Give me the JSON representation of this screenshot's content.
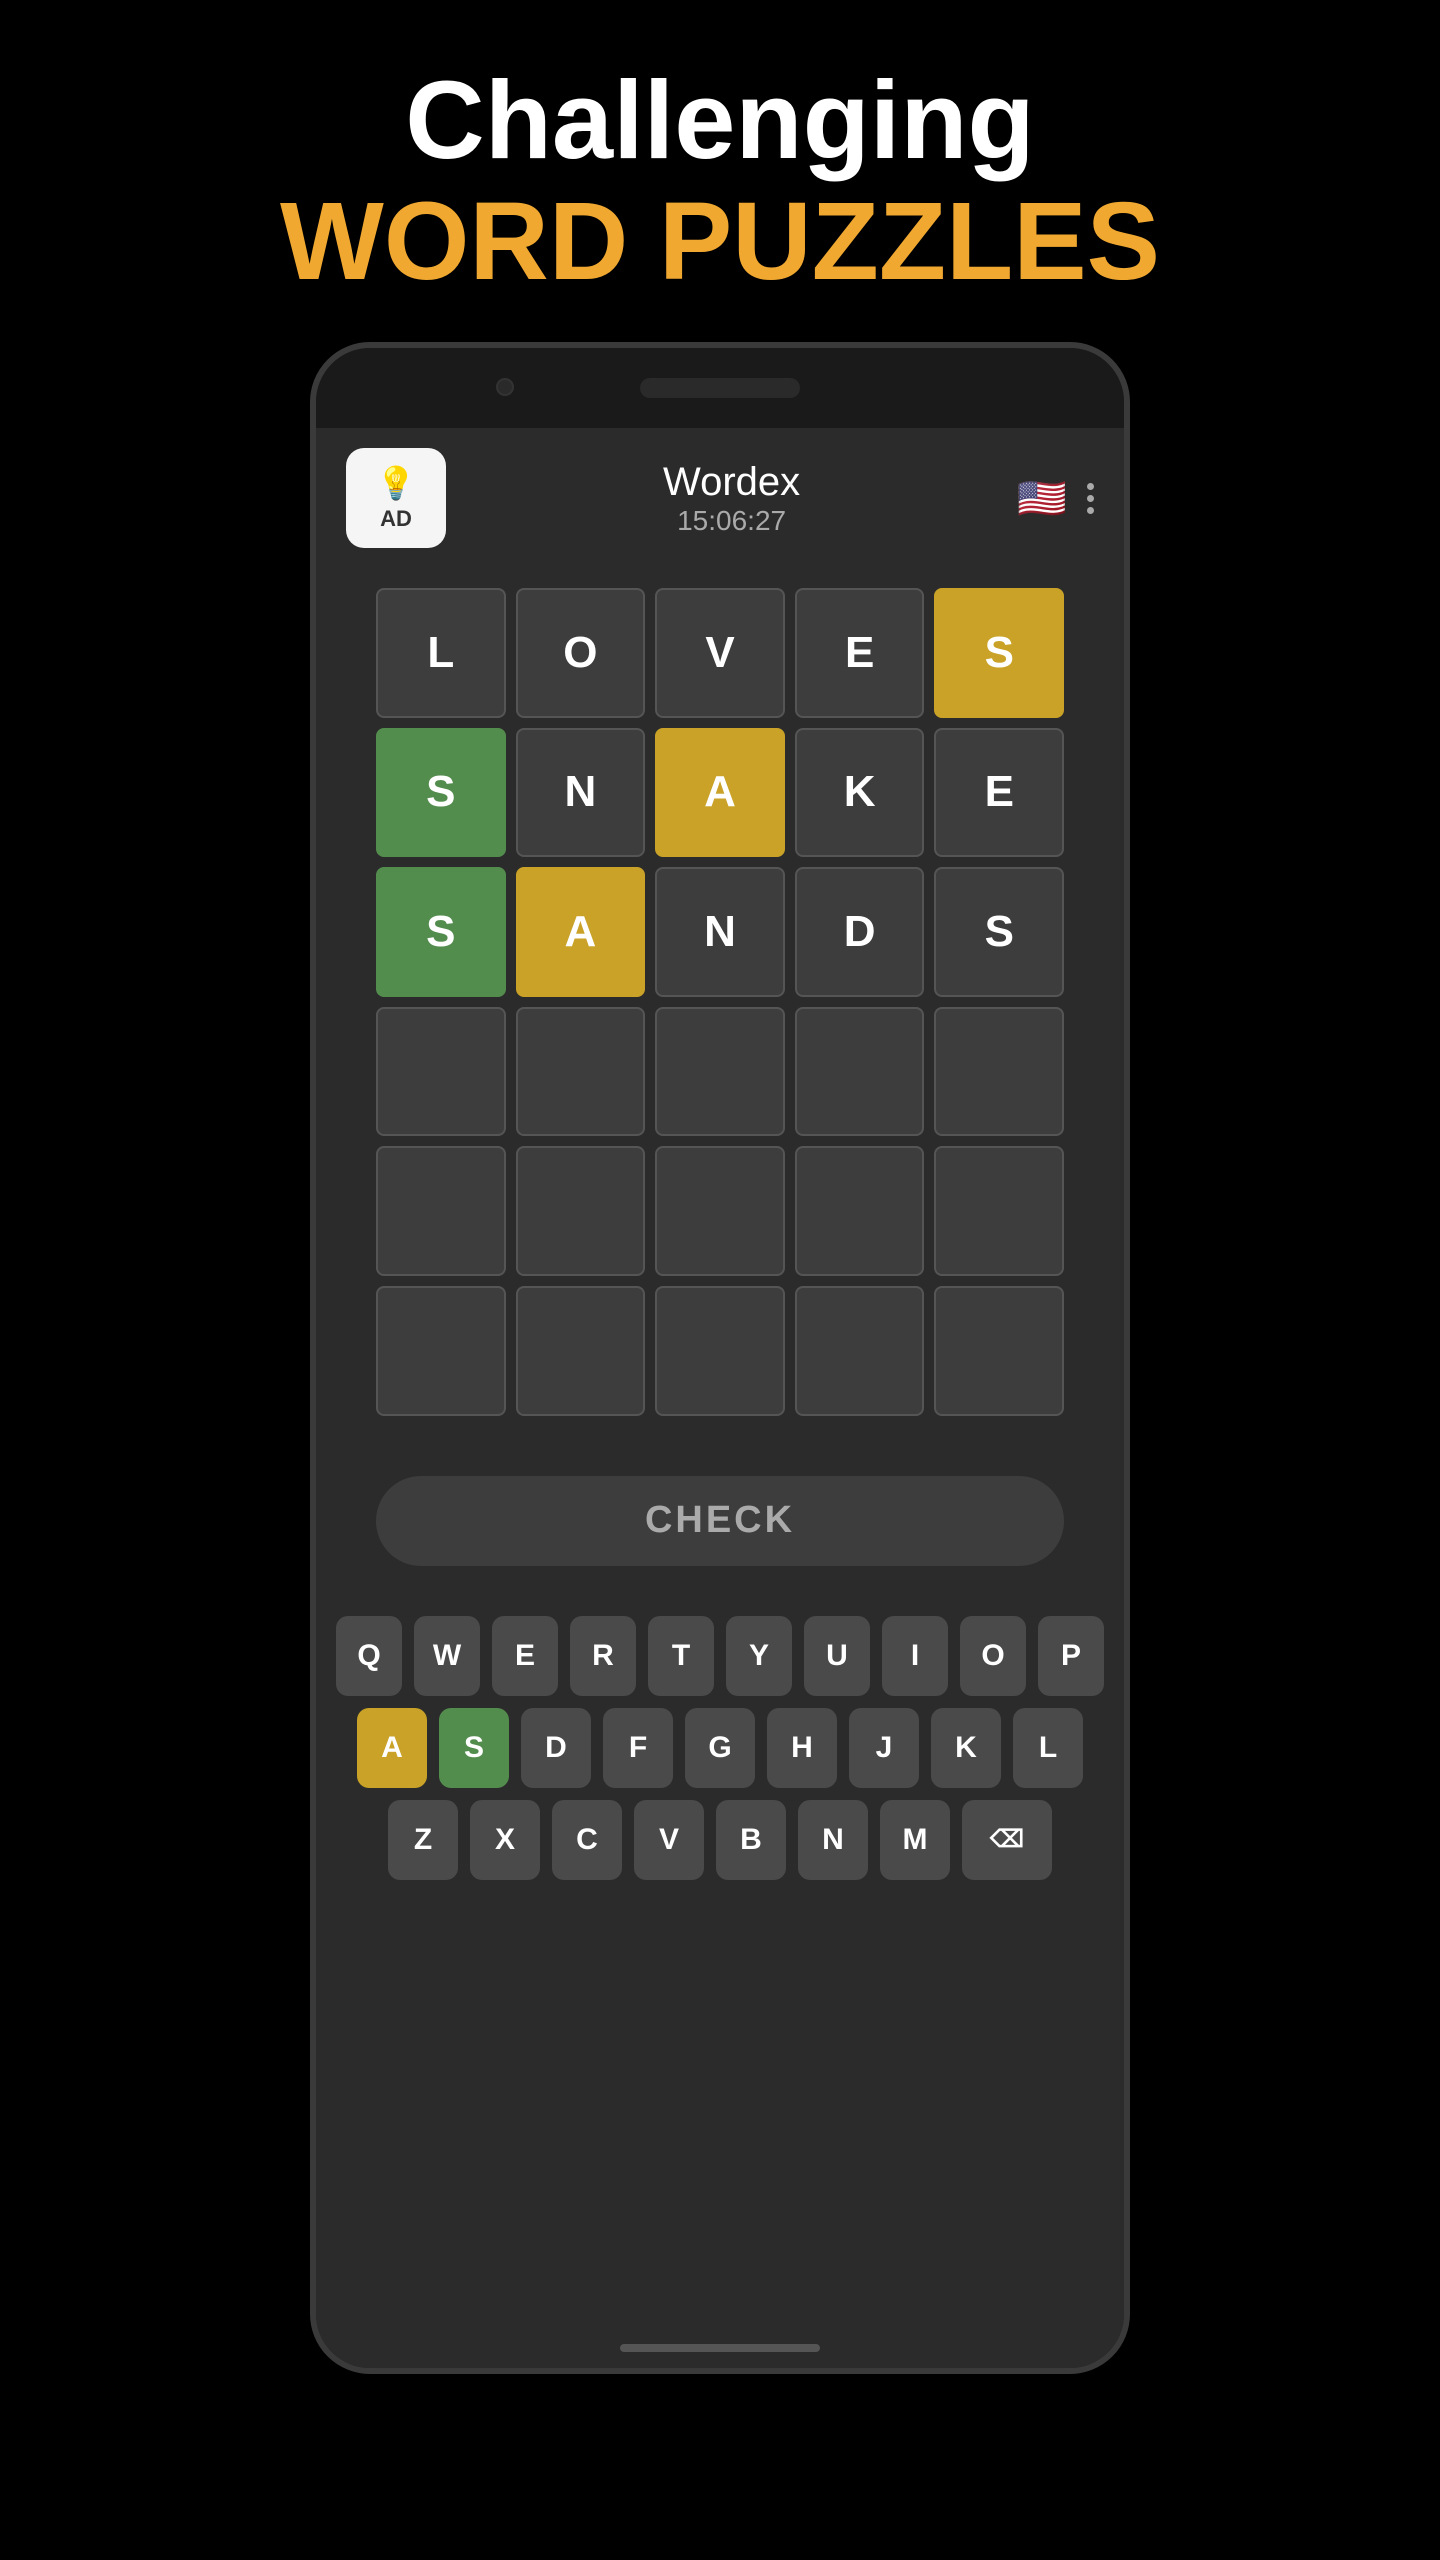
{
  "header": {
    "line1": "Challenging",
    "line2": "WORD PUZZLES"
  },
  "app": {
    "title": "Wordex",
    "timer": "15:06:27",
    "ad_label": "AD",
    "check_label": "CHECK"
  },
  "grid": {
    "rows": [
      [
        {
          "letter": "L",
          "state": "empty"
        },
        {
          "letter": "O",
          "state": "empty"
        },
        {
          "letter": "V",
          "state": "empty"
        },
        {
          "letter": "E",
          "state": "empty"
        },
        {
          "letter": "S",
          "state": "yellow"
        }
      ],
      [
        {
          "letter": "S",
          "state": "green"
        },
        {
          "letter": "N",
          "state": "empty"
        },
        {
          "letter": "A",
          "state": "yellow"
        },
        {
          "letter": "K",
          "state": "empty"
        },
        {
          "letter": "E",
          "state": "empty"
        }
      ],
      [
        {
          "letter": "S",
          "state": "green"
        },
        {
          "letter": "A",
          "state": "yellow"
        },
        {
          "letter": "N",
          "state": "empty"
        },
        {
          "letter": "D",
          "state": "empty"
        },
        {
          "letter": "S",
          "state": "empty"
        }
      ],
      [
        {
          "letter": "",
          "state": "empty"
        },
        {
          "letter": "",
          "state": "empty"
        },
        {
          "letter": "",
          "state": "empty"
        },
        {
          "letter": "",
          "state": "empty"
        },
        {
          "letter": "",
          "state": "empty"
        }
      ],
      [
        {
          "letter": "",
          "state": "empty"
        },
        {
          "letter": "",
          "state": "empty"
        },
        {
          "letter": "",
          "state": "empty"
        },
        {
          "letter": "",
          "state": "empty"
        },
        {
          "letter": "",
          "state": "empty"
        }
      ],
      [
        {
          "letter": "",
          "state": "empty"
        },
        {
          "letter": "",
          "state": "empty"
        },
        {
          "letter": "",
          "state": "empty"
        },
        {
          "letter": "",
          "state": "empty"
        },
        {
          "letter": "",
          "state": "empty"
        }
      ]
    ]
  },
  "keyboard": {
    "rows": [
      [
        "Q",
        "W",
        "E",
        "R",
        "T",
        "Y",
        "U",
        "I",
        "O",
        "P"
      ],
      [
        "A",
        "S",
        "D",
        "F",
        "G",
        "H",
        "J",
        "K",
        "L"
      ],
      [
        "Z",
        "X",
        "C",
        "V",
        "B",
        "N",
        "M",
        "⌫"
      ]
    ],
    "yellow_keys": [
      "A"
    ],
    "green_keys": [
      "S"
    ]
  }
}
